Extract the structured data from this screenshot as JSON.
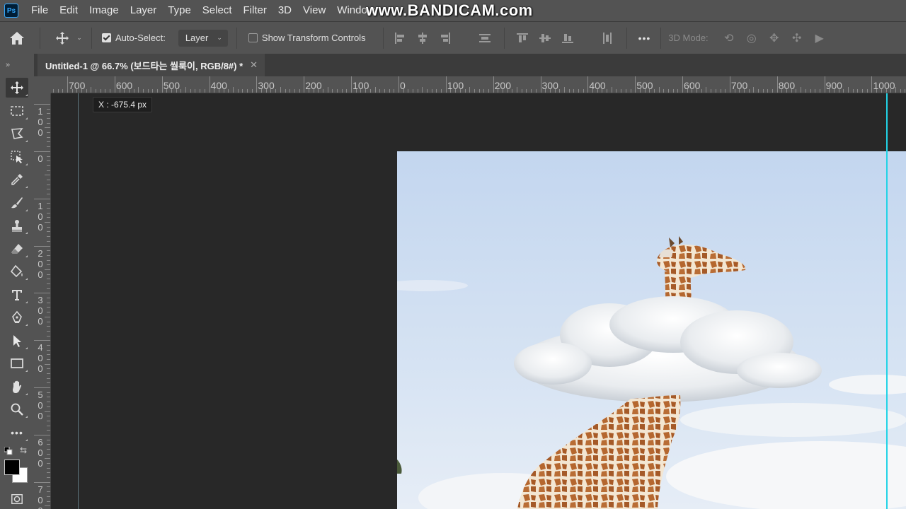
{
  "menu": {
    "app_icon_text": "Ps",
    "items": [
      "File",
      "Edit",
      "Image",
      "Layer",
      "Type",
      "Select",
      "Filter",
      "3D",
      "View",
      "Window"
    ],
    "watermark": "www.BANDICAM.com"
  },
  "options_bar": {
    "auto_select_label": "Auto-Select:",
    "auto_select_checked": true,
    "auto_select_target": "Layer",
    "show_transform_label": "Show Transform Controls",
    "show_transform_checked": false,
    "mode_3d_label": "3D Mode:",
    "more_label": "•••"
  },
  "document_tab": {
    "title": "Untitled-1 @ 66.7% (보드타는 씰룩이, RGB/8#) *",
    "close": "✕"
  },
  "toolbar": {
    "collapse": "»",
    "tools": [
      "move-tool",
      "marquee-tool",
      "lasso-tool",
      "object-select-tool",
      "eyedropper-tool",
      "brush-tool",
      "stamp-tool",
      "eraser-tool",
      "paint-bucket-tool",
      "type-tool",
      "pen-tool",
      "path-select-tool",
      "rectangle-tool",
      "hand-tool",
      "zoom-tool",
      "more-tools"
    ],
    "active_tool": "move-tool",
    "foreground_color": "#000000",
    "background_color": "#ffffff"
  },
  "rulers": {
    "horizontal_labels": [
      "700",
      "600",
      "500",
      "400",
      "300",
      "200",
      "100",
      "0",
      "100",
      "200",
      "300",
      "400",
      "500",
      "600",
      "700",
      "800",
      "900",
      "1000"
    ],
    "vertical_labels": [
      "100",
      "0",
      "100",
      "200",
      "300",
      "400",
      "500",
      "600",
      "700"
    ]
  },
  "canvas": {
    "tooltip": "X :  -675.4 px",
    "colors": {
      "guide": "#22d3e6",
      "sky_top": "#c9daf0",
      "sky_bottom": "#dfe9f5"
    }
  }
}
